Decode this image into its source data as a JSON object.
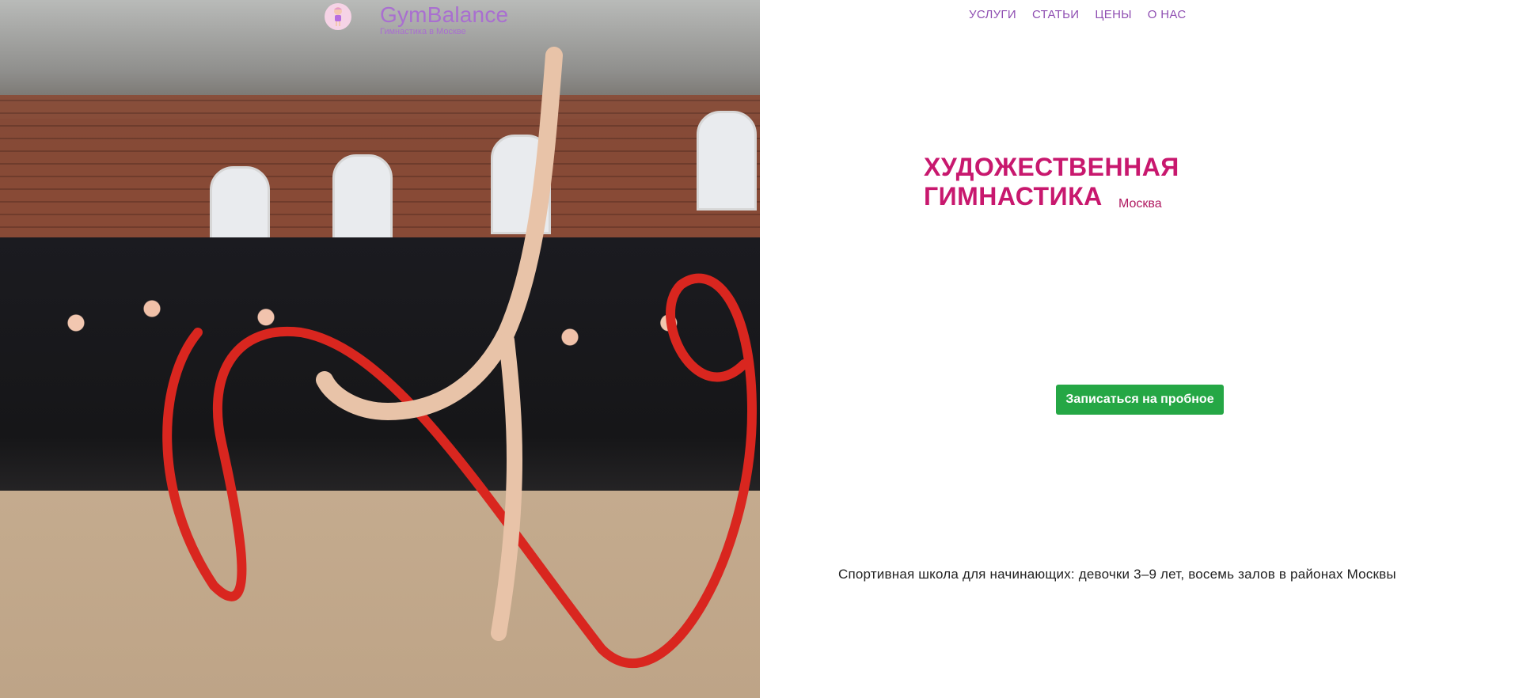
{
  "logo": {
    "name": "GymBalance",
    "subtitle": "Гимнастика в Москве",
    "icon": "gymnast-girl-icon"
  },
  "nav": {
    "items": [
      "УСЛУГИ",
      "СТАТЬИ",
      "ЦЕНЫ",
      "О НАС"
    ]
  },
  "hero": {
    "title": "ХУДОЖЕСТВЕННАЯ ГИМНАСТИКА",
    "city": "Москва",
    "cta_label": "Записаться на пробное",
    "tagline": "Спортивная школа для начинающих: девочки 3–9 лет, восемь залов в районах Москвы"
  },
  "colors": {
    "accent": "#c8186e",
    "nav": "#8f4fb2",
    "cta": "#25a745",
    "logo": "#a96fd0"
  }
}
